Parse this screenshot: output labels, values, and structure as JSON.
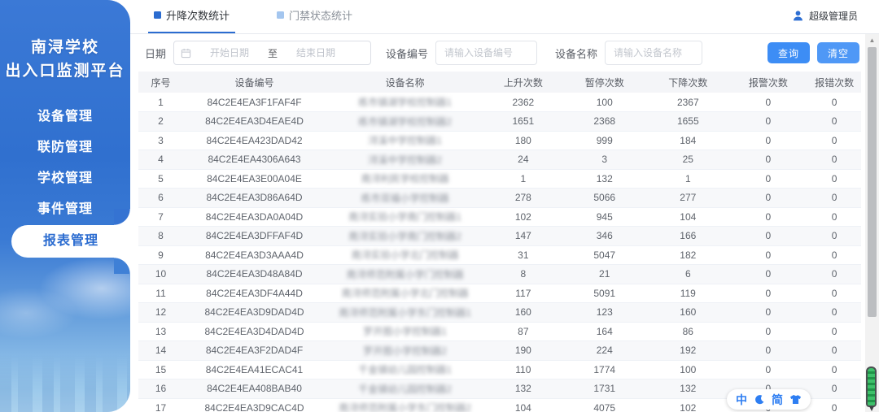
{
  "sidebar": {
    "title_line1": "南浔学校",
    "title_line2": "出入口监测平台",
    "items": [
      {
        "label": "设备管理",
        "active": false
      },
      {
        "label": "联防管理",
        "active": false
      },
      {
        "label": "学校管理",
        "active": false
      },
      {
        "label": "事件管理",
        "active": false
      },
      {
        "label": "报表管理",
        "active": true
      }
    ]
  },
  "header": {
    "tabs": [
      {
        "label": "升降次数统计",
        "active": true
      },
      {
        "label": "门禁状态统计",
        "active": false
      }
    ],
    "user_name": "超级管理员"
  },
  "filters": {
    "date_label": "日期",
    "date_start_placeholder": "开始日期",
    "date_separator": "至",
    "date_end_placeholder": "结束日期",
    "device_id_label": "设备编号",
    "device_id_placeholder": "请输入设备编号",
    "device_name_label": "设备名称",
    "device_name_placeholder": "请输入设备名称",
    "search_button": "查询",
    "clear_button": "清空"
  },
  "table": {
    "columns": [
      "序号",
      "设备编号",
      "设备名称",
      "上升次数",
      "暂停次数",
      "下降次数",
      "报警次数",
      "报错次数"
    ],
    "rows": [
      [
        "1",
        "84C2E4EA3F1FAF4F",
        "练市镇湖学校控制器1",
        "2362",
        "100",
        "2367",
        "0",
        "0"
      ],
      [
        "2",
        "84C2E4EA3D4EAE4D",
        "练市镇湖学校控制器2",
        "1651",
        "2368",
        "1655",
        "0",
        "0"
      ],
      [
        "3",
        "84C2E4EA423DAD42",
        "浔溪中学控制器1",
        "180",
        "999",
        "184",
        "0",
        "0"
      ],
      [
        "4",
        "84C2E4EA4306A643",
        "浔溪中学控制器2",
        "24",
        "3",
        "25",
        "0",
        "0"
      ],
      [
        "5",
        "84C2E4EA3E00A04E",
        "南浔利民学校控制器",
        "1",
        "132",
        "1",
        "0",
        "0"
      ],
      [
        "6",
        "84C2E4EA3D86A64D",
        "练市双福小学控制器",
        "278",
        "5066",
        "277",
        "0",
        "0"
      ],
      [
        "7",
        "84C2E4EA3DA0A04D",
        "南浔实验小学南门控制器1",
        "102",
        "945",
        "104",
        "0",
        "0"
      ],
      [
        "8",
        "84C2E4EA3DFFAF4D",
        "南浔实验小学南门控制器2",
        "147",
        "346",
        "166",
        "0",
        "0"
      ],
      [
        "9",
        "84C2E4EA3D3AAA4D",
        "南浔实验小学北门控制器",
        "31",
        "5047",
        "182",
        "0",
        "0"
      ],
      [
        "10",
        "84C2E4EA3D48A84D",
        "南浔师范附属小学门控制器",
        "8",
        "21",
        "6",
        "0",
        "0"
      ],
      [
        "11",
        "84C2E4EA3DF4A44D",
        "南浔师范附属小学北门控制器",
        "117",
        "5091",
        "119",
        "0",
        "0"
      ],
      [
        "12",
        "84C2E4EA3D9DAD4D",
        "南浔师范附属小学东门控制器1",
        "160",
        "123",
        "160",
        "0",
        "0"
      ],
      [
        "13",
        "84C2E4EA3D4DAD4D",
        "罗开图小学控制器1",
        "87",
        "164",
        "86",
        "0",
        "0"
      ],
      [
        "14",
        "84C2E4EA3F2DAD4F",
        "罗开图小学控制器2",
        "190",
        "224",
        "192",
        "0",
        "0"
      ],
      [
        "15",
        "84C2E4EA41ECAC41",
        "千金镇幼儿园控制器1",
        "110",
        "1774",
        "100",
        "0",
        "0"
      ],
      [
        "16",
        "84C2E4EA408BAB40",
        "千金镇幼儿园控制器2",
        "132",
        "1731",
        "132",
        "0",
        "0"
      ],
      [
        "17",
        "84C2E4EA3D9CAC4D",
        "南浔师范附属小学东门控制器2",
        "104",
        "4075",
        "102",
        "0",
        "0"
      ]
    ],
    "column_widths": [
      "6.2%",
      "19.7%",
      "22%",
      "10.7%",
      "11.8%",
      "11.3%",
      "10.9%",
      "7.4%"
    ]
  },
  "ime": {
    "lang_mode": "中",
    "charset_mode": "简"
  },
  "colors": {
    "sidebar_blue": "#3070cf",
    "accent_blue": "#2b6cd0",
    "button_blue": "#3d8df5",
    "tab_inactive_bullet": "#a4c6ef",
    "table_header_bg": "#f4f5f8",
    "ime_blue": "#2e7ef2",
    "pen_green": "#3ec06a"
  }
}
